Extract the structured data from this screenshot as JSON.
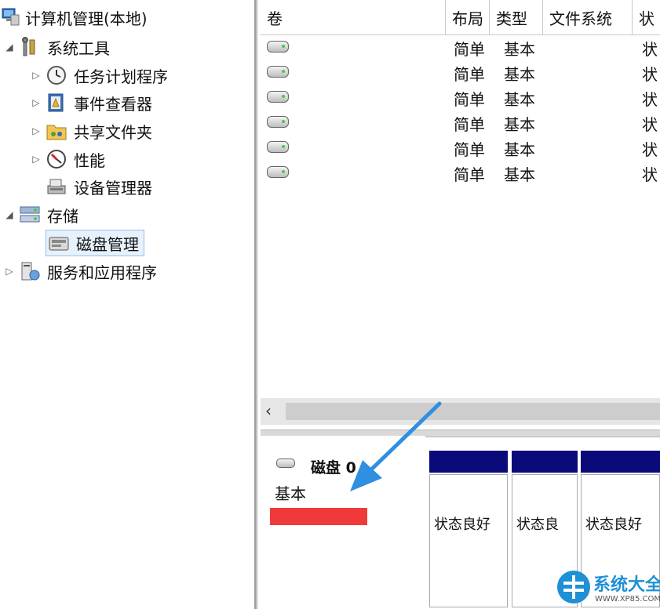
{
  "tree": {
    "root": "计算机管理(本地)",
    "items": [
      {
        "label": "系统工具",
        "icon": "tools-icon",
        "arrow": "expanded"
      },
      {
        "label": "任务计划程序",
        "icon": "clock-icon",
        "arrow": "collapsed"
      },
      {
        "label": "事件查看器",
        "icon": "event-viewer-icon",
        "arrow": "collapsed"
      },
      {
        "label": "共享文件夹",
        "icon": "shared-folder-icon",
        "arrow": "collapsed"
      },
      {
        "label": "性能",
        "icon": "performance-icon",
        "arrow": "collapsed"
      },
      {
        "label": "设备管理器",
        "icon": "device-manager-icon",
        "arrow": "none"
      },
      {
        "label": "存储",
        "icon": "storage-icon",
        "arrow": "expanded"
      },
      {
        "label": "磁盘管理",
        "icon": "disk-management-icon",
        "arrow": "none",
        "selected": true
      },
      {
        "label": "服务和应用程序",
        "icon": "services-icon",
        "arrow": "collapsed"
      }
    ]
  },
  "volumes": {
    "columns": [
      "卷",
      "布局",
      "类型",
      "文件系统",
      "状"
    ],
    "rows": [
      {
        "layout": "简单",
        "type": "基本",
        "status": "状"
      },
      {
        "layout": "简单",
        "type": "基本",
        "status": "状"
      },
      {
        "layout": "简单",
        "type": "基本",
        "status": "状"
      },
      {
        "layout": "简单",
        "type": "基本",
        "status": "状"
      },
      {
        "layout": "简单",
        "type": "基本",
        "status": "状"
      },
      {
        "layout": "简单",
        "type": "基本",
        "status": "状"
      }
    ],
    "scroll_left": "‹"
  },
  "disk": {
    "name": "磁盘 0",
    "type": "基本",
    "partitions": [
      {
        "status": "状态良好"
      },
      {
        "status": "状态良"
      },
      {
        "status": "状态良好"
      }
    ]
  },
  "watermark": {
    "text": "系统大全",
    "url": "WWW.XP85.COM"
  },
  "colors": {
    "partition_bar": "#0a0a7a",
    "arrow": "#2f8fe0",
    "redaction": "#f03a3a",
    "watermark": "#1e90d6"
  }
}
